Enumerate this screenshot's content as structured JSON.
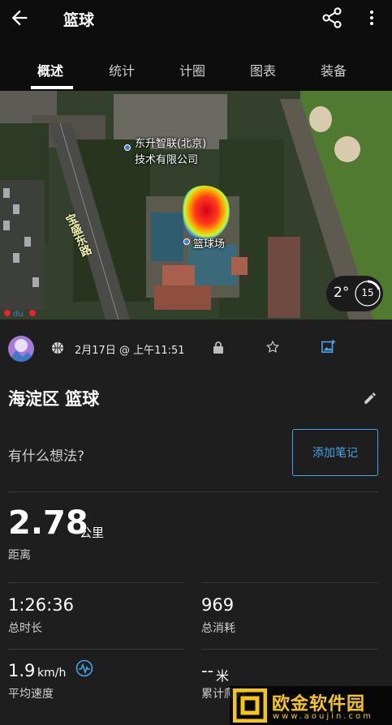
{
  "header": {
    "title": "篮球",
    "icons": [
      "back-arrow-icon",
      "share-icon",
      "more-vert-icon"
    ]
  },
  "tabs": [
    {
      "label": "概述",
      "active": true
    },
    {
      "label": "统计",
      "active": false
    },
    {
      "label": "计圈",
      "active": false
    },
    {
      "label": "图表",
      "active": false
    },
    {
      "label": "装备",
      "active": false
    }
  ],
  "map": {
    "poi_company_line1": "东升智联(北京)",
    "poi_company_line2": "技术有限公司",
    "poi_court": "篮球场",
    "road_name": "宝盛东路",
    "provider": "du",
    "temperature": "2°",
    "wind": "15"
  },
  "activity": {
    "date": "2月17日 @ 上午11:51",
    "title": "海淀区 篮球",
    "thoughts_placeholder": "有什么想法?",
    "add_note_label": "添加笔记"
  },
  "stats": {
    "distance_value": "2.78",
    "distance_unit": "公里",
    "distance_label": "距离",
    "total_time_value": "1:26:36",
    "total_time_label": "总时长",
    "calories_value": "969",
    "calories_label": "总消耗",
    "avg_speed_value": "1.9",
    "avg_speed_unit": "km/h",
    "avg_speed_label": "平均速度",
    "ascent_value": "--",
    "ascent_unit": "米",
    "ascent_label": "累计爬升"
  },
  "watermark": {
    "title": "欧金软件园",
    "url": "www.aoujin.com"
  },
  "colors": {
    "background": "#1e1e1e",
    "header": "#0d0d0d",
    "accent": "#4aa3e6"
  }
}
